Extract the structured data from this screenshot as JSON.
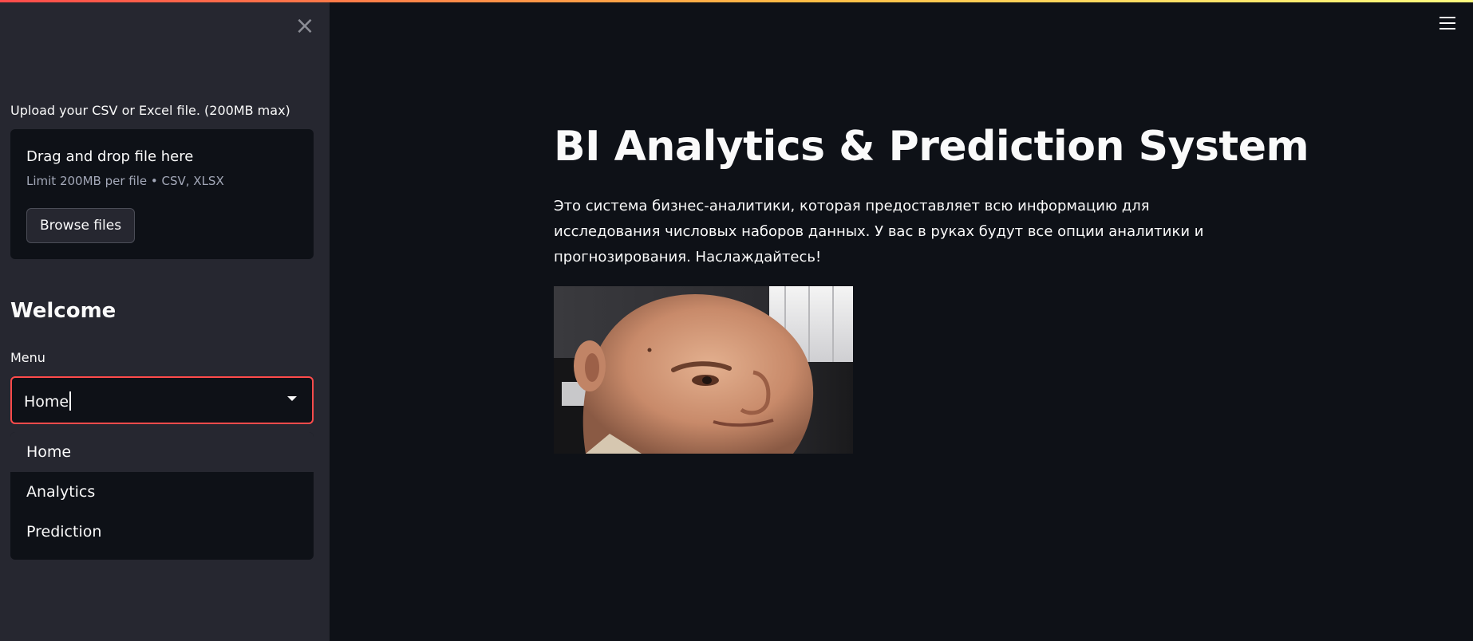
{
  "sidebar": {
    "close_icon": "×",
    "upload_label": "Upload your CSV or Excel file. (200MB max)",
    "dropzone": {
      "title": "Drag and drop file here",
      "limit": "Limit 200MB per file • CSV, XLSX",
      "browse_button": "Browse files"
    },
    "welcome_heading": "Welcome",
    "menu_label": "Menu",
    "select": {
      "value": "Home",
      "options": [
        "Home",
        "Analytics",
        "Prediction"
      ]
    }
  },
  "main": {
    "title": "BI Analytics & Prediction System",
    "description": "Это система бизнес-аналитики, которая предоставляет всю информацию для исследования числовых наборов данных. У вас в руках будут все опции аналитики и прогнозирования. Наслаждайтесь!"
  },
  "colors": {
    "app_bg": "#0e1117",
    "sidebar_bg": "#262730",
    "accent": "#ff4b4b",
    "text": "#fafafa",
    "muted_text": "#a3a8b8"
  },
  "icons": {
    "close": "close-icon",
    "dropdown": "chevron-down-icon",
    "menu": "hamburger-menu-icon"
  }
}
